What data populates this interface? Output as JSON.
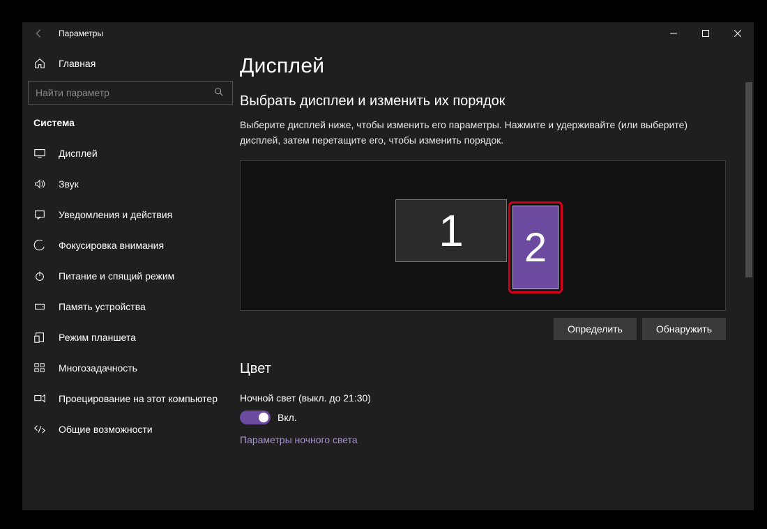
{
  "title": "Параметры",
  "home": "Главная",
  "search_placeholder": "Найти параметр",
  "category": "Система",
  "nav": [
    {
      "label": "Дисплей"
    },
    {
      "label": "Звук"
    },
    {
      "label": "Уведомления и действия"
    },
    {
      "label": "Фокусировка внимания"
    },
    {
      "label": "Питание и спящий режим"
    },
    {
      "label": "Память устройства"
    },
    {
      "label": "Режим планшета"
    },
    {
      "label": "Многозадачность"
    },
    {
      "label": "Проецирование на этот компьютер"
    },
    {
      "label": "Общие возможности"
    }
  ],
  "page": {
    "heading": "Дисплей",
    "arrange_title": "Выбрать дисплеи и изменить их порядок",
    "arrange_desc": "Выберите дисплей ниже, чтобы изменить его параметры. Нажмите и удерживайте (или выберите) дисплей, затем перетащите его, чтобы изменить порядок.",
    "monitor1": "1",
    "monitor2": "2",
    "identify": "Определить",
    "detect": "Обнаружить",
    "color_heading": "Цвет",
    "night_light_label": "Ночной свет (выкл. до 21:30)",
    "toggle_state": "Вкл.",
    "night_light_link": "Параметры ночного света"
  }
}
